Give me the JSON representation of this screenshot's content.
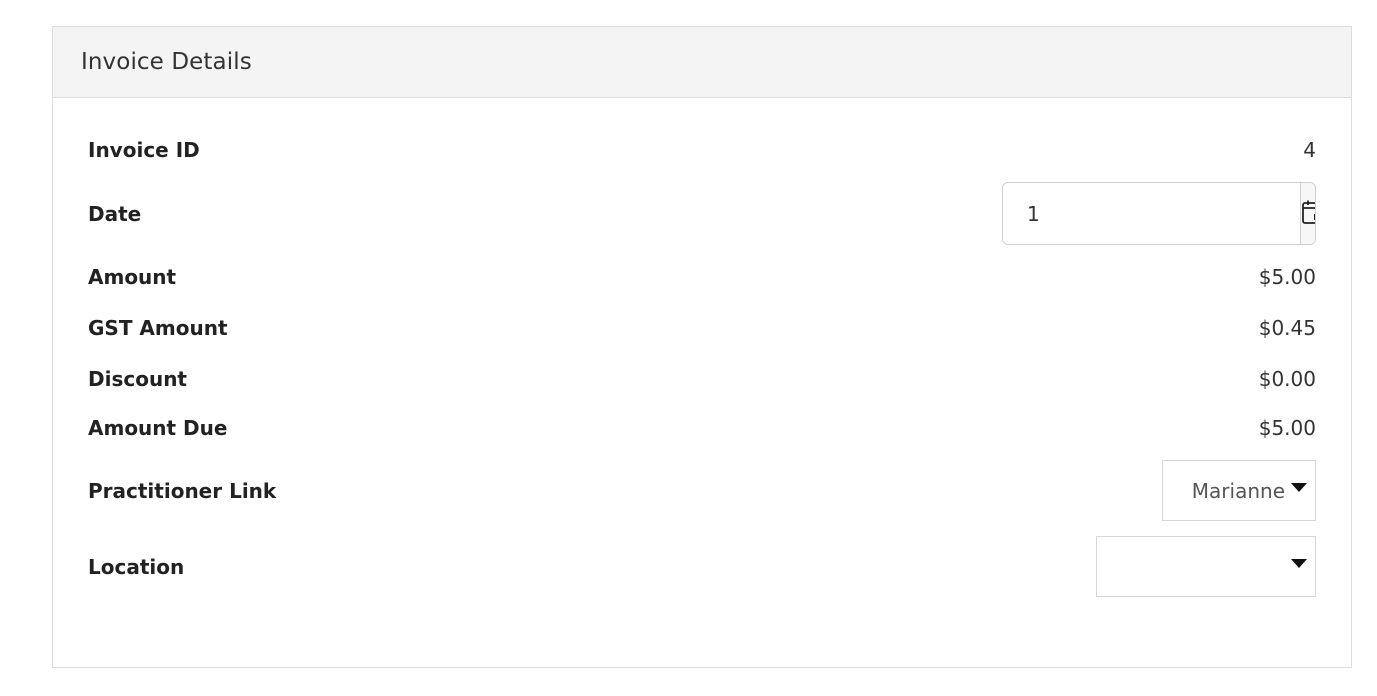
{
  "panel": {
    "title": "Invoice Details"
  },
  "fields": {
    "invoice_id": {
      "label": "Invoice ID",
      "value": "4"
    },
    "date": {
      "label": "Date",
      "value": "1",
      "button_icon": "calendar-icon"
    },
    "amount": {
      "label": "Amount",
      "value": "$5.00"
    },
    "gst_amount": {
      "label": "GST Amount",
      "value": "$0.45"
    },
    "discount": {
      "label": "Discount",
      "value": "$0.00"
    },
    "amount_due": {
      "label": "Amount Due",
      "value": "$5.00"
    },
    "practitioner_link": {
      "label": "Practitioner Link",
      "selected": "Marianne",
      "icon": "caret-down-icon"
    },
    "location": {
      "label": "Location",
      "selected": "",
      "icon": "caret-down-icon"
    }
  }
}
